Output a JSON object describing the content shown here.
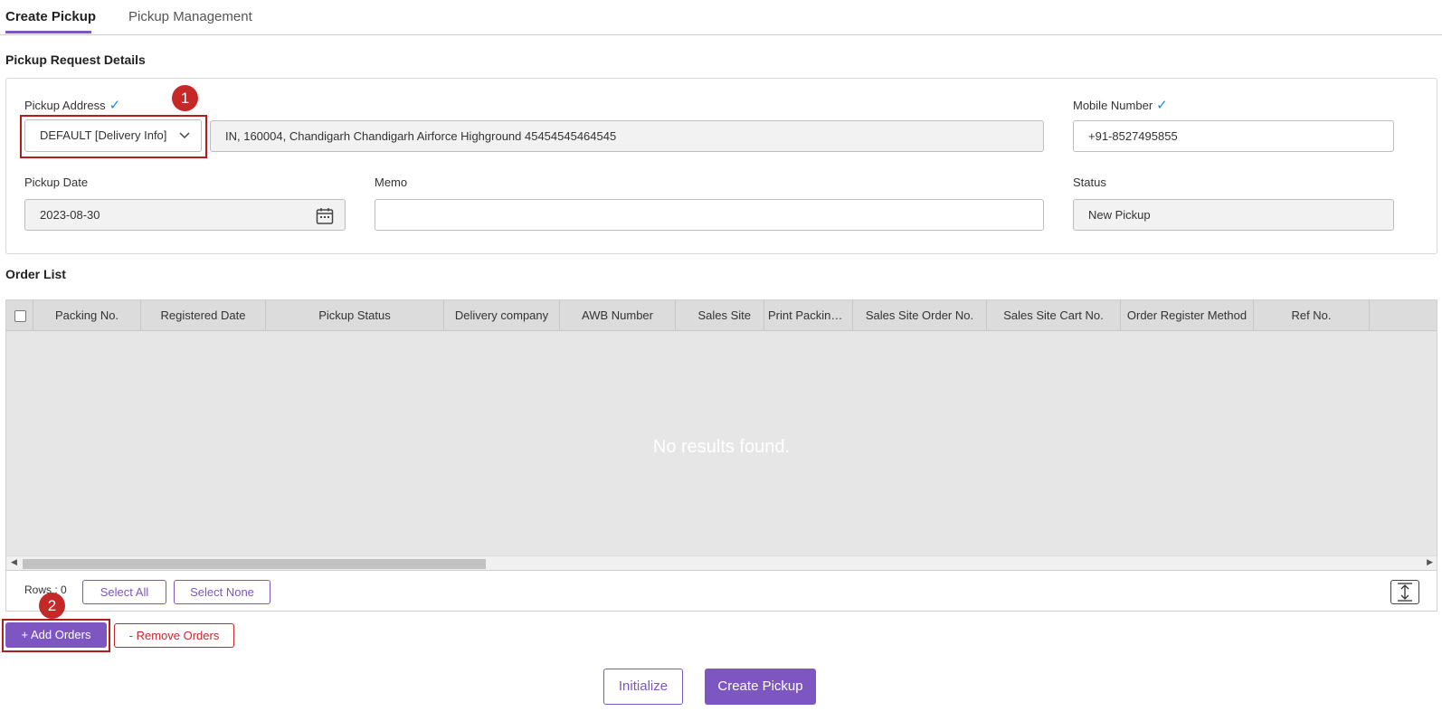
{
  "tabs": [
    {
      "label": "Create Pickup",
      "active": true
    },
    {
      "label": "Pickup Management",
      "active": false
    }
  ],
  "sections": {
    "details_title": "Pickup Request Details",
    "order_list_title": "Order List"
  },
  "pickup_address": {
    "label": "Pickup Address",
    "selected": "DEFAULT [Delivery Info]",
    "address": "IN, 160004, Chandigarh Chandigarh Airforce Highground 45454545464545"
  },
  "mobile": {
    "label": "Mobile Number",
    "value": "+91-8527495855"
  },
  "pickup_date": {
    "label": "Pickup Date",
    "value": "2023-08-30"
  },
  "memo": {
    "label": "Memo",
    "value": ""
  },
  "status": {
    "label": "Status",
    "value": "New Pickup"
  },
  "badges": {
    "one": "1",
    "two": "2"
  },
  "grid": {
    "columns": [
      "Packing No.",
      "Registered Date",
      "Pickup Status",
      "Delivery company",
      "AWB Number",
      "Sales Site",
      "Print Packing ...",
      "Sales Site Order No.",
      "Sales Site Cart No.",
      "Order Register Method",
      "Ref No."
    ],
    "empty_text": "No results found.",
    "rows_label": "Rows : 0",
    "select_all": "Select All",
    "select_none": "Select None"
  },
  "actions": {
    "add_orders": "+ Add Orders",
    "remove_orders": "- Remove Orders",
    "initialize": "Initialize",
    "create_pickup": "Create Pickup"
  },
  "colors": {
    "accent": "#7d56c2",
    "danger": "#c62828",
    "check": "#1e88e5"
  }
}
